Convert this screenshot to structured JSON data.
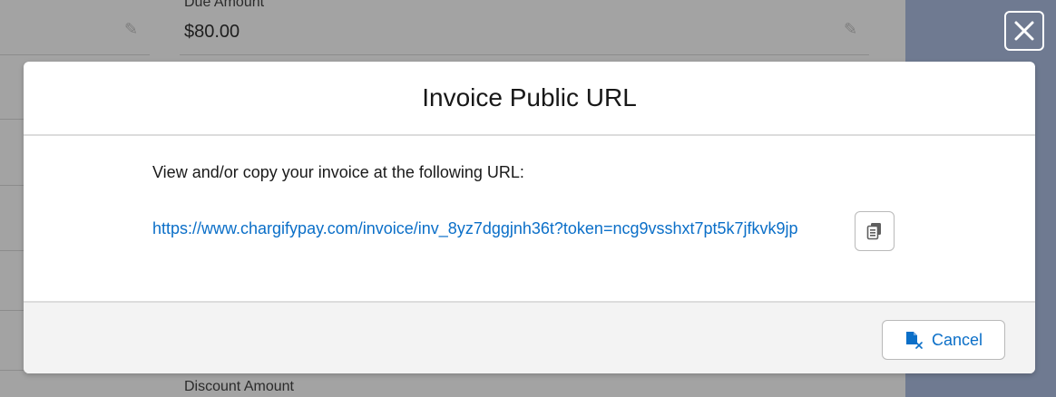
{
  "background": {
    "due_amount_label": "Due Amount",
    "due_amount_value": "$80.00",
    "discount_amount_label": "Discount Amount"
  },
  "modal": {
    "title": "Invoice Public URL",
    "intro_text": "View and/or copy your invoice at the following URL:",
    "url": "https://www.chargifypay.com/invoice/inv_8yz7dggjnh36t?token=ncg9vsshxt7pt5k7jfkvk9jp",
    "cancel_label": "Cancel"
  },
  "icons": {
    "close": "close-icon",
    "copy": "copy-icon",
    "cancel": "cancel-document-icon",
    "edit": "pencil-icon"
  },
  "colors": {
    "link": "#0b6fc8",
    "overlay_right": "#6f7a91",
    "footer_bg": "#f3f3f3"
  }
}
